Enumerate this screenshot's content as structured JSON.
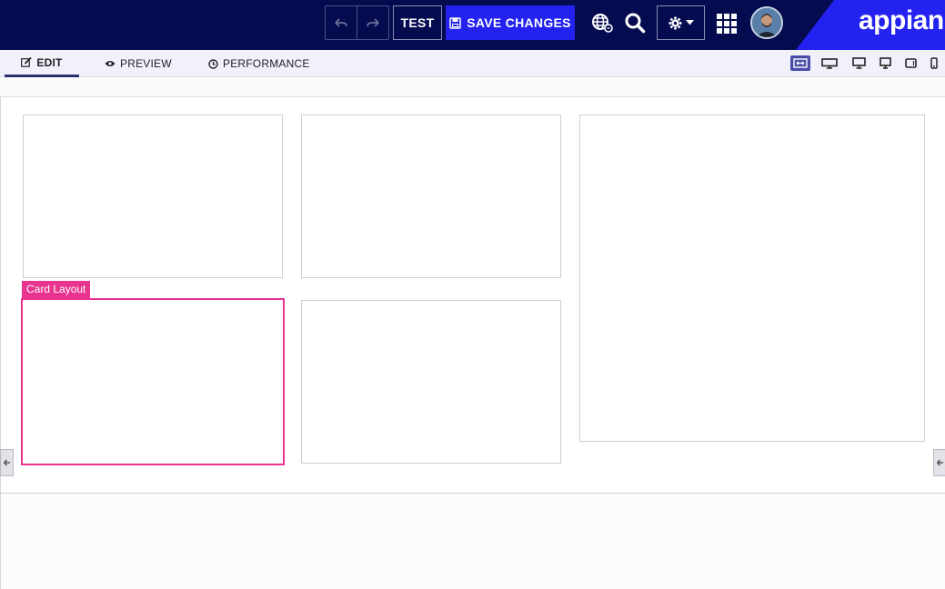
{
  "toolbar": {
    "test_label": "TEST",
    "save_label": "SAVE CHANGES"
  },
  "brand": {
    "name": "appian"
  },
  "tabs": [
    {
      "label": "EDIT",
      "icon": "edit-icon",
      "active": true
    },
    {
      "label": "PREVIEW",
      "icon": "eye-icon",
      "active": false
    },
    {
      "label": "PERFORMANCE",
      "icon": "clock-icon",
      "active": false
    }
  ],
  "device_options": [
    {
      "icon": "fit-width-icon",
      "active": true
    },
    {
      "icon": "wide-monitor-icon",
      "active": false
    },
    {
      "icon": "desktop-icon",
      "active": false
    },
    {
      "icon": "laptop-icon",
      "active": false
    },
    {
      "icon": "tablet-icon",
      "active": false
    },
    {
      "icon": "phone-icon",
      "active": false
    }
  ],
  "selection": {
    "label": "Card Layout"
  },
  "colors": {
    "header_bg": "#050b4f",
    "accent": "#2322f0",
    "selection": "#e8338f",
    "active_device": "#4b4ea8"
  }
}
